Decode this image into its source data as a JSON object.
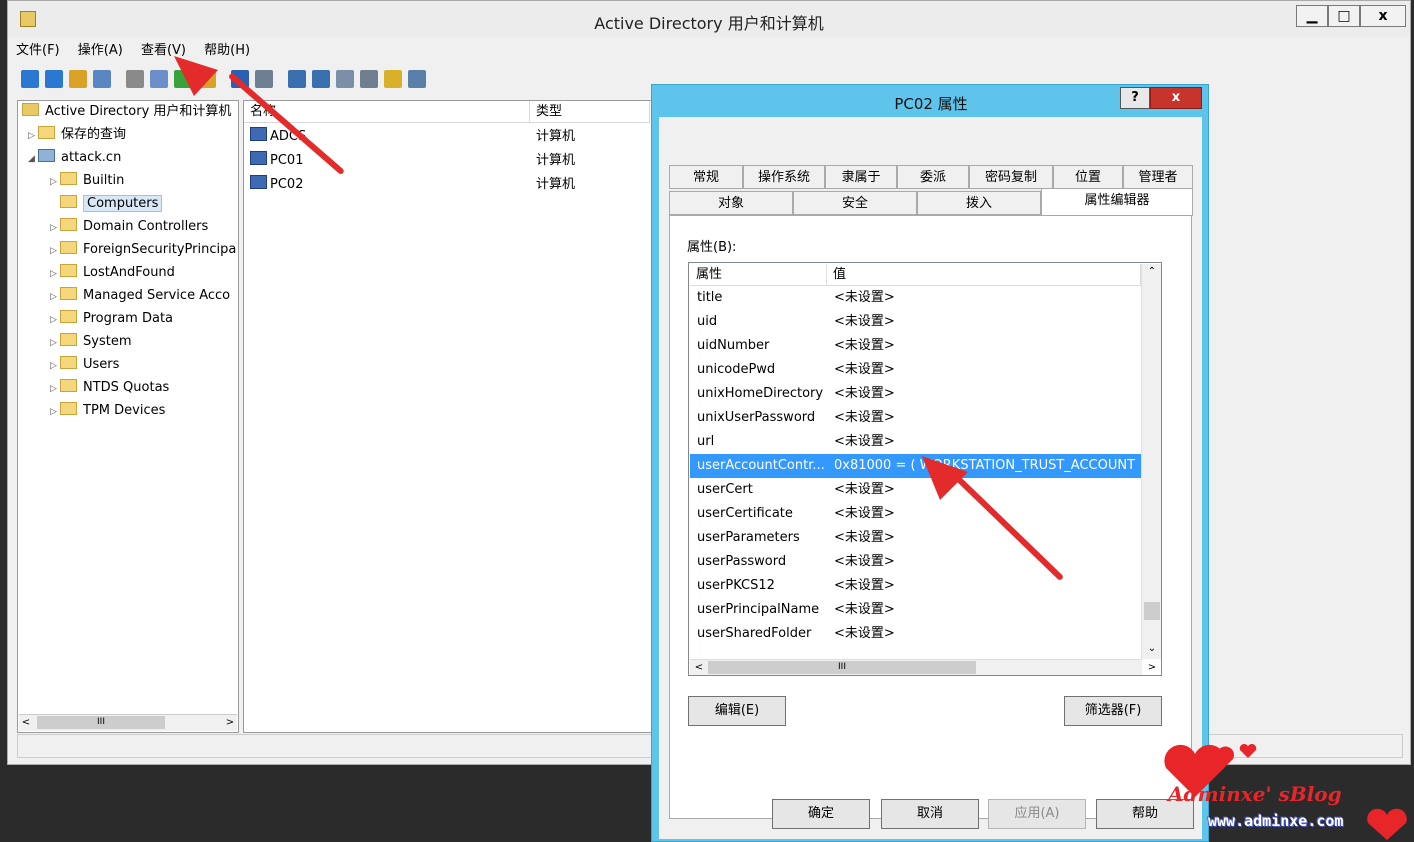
{
  "window": {
    "title": "Active Directory 用户和计算机",
    "controls": {
      "minimize": "▁",
      "maximize": "□",
      "close": "x"
    }
  },
  "menu": [
    "文件(F)",
    "操作(A)",
    "查看(V)",
    "帮助(H)"
  ],
  "toolbar_icons": [
    "back-icon",
    "forward-icon",
    "up-icon",
    "show-tree-icon",
    "clipboard-icon",
    "export-icon",
    "refresh-icon",
    "export-list-icon",
    "help-icon",
    "console-icon",
    "new-user-icon",
    "new-group-icon",
    "new-ou-icon",
    "filter-icon",
    "find-icon",
    "add-to-group-icon"
  ],
  "tree": {
    "root": "Active Directory 用户和计算机",
    "saved_queries": "保存的查询",
    "domain": "attack.cn",
    "children": [
      "Builtin",
      "Computers",
      "Domain Controllers",
      "ForeignSecurityPrincipa",
      "LostAndFound",
      "Managed Service Acco",
      "Program Data",
      "System",
      "Users",
      "NTDS Quotas",
      "TPM Devices"
    ],
    "selected": "Computers",
    "scroll_label": "III"
  },
  "list": {
    "headers": [
      "名称",
      "类型"
    ],
    "rows": [
      {
        "name": "ADCS",
        "type": "计算机"
      },
      {
        "name": "PC01",
        "type": "计算机"
      },
      {
        "name": "PC02",
        "type": "计算机"
      }
    ]
  },
  "dialog": {
    "title": "PC02 属性",
    "help": "?",
    "close": "x",
    "tabs_row1": [
      "常规",
      "操作系统",
      "隶属于",
      "委派",
      "密码复制",
      "位置",
      "管理者"
    ],
    "tabs_row2": [
      "对象",
      "安全",
      "拨入",
      "属性编辑器"
    ],
    "active_tab": "属性编辑器",
    "attributes_label": "属性(B):",
    "columns": [
      "属性",
      "值"
    ],
    "rows": [
      {
        "name": "title",
        "value": "<未设置>"
      },
      {
        "name": "uid",
        "value": "<未设置>"
      },
      {
        "name": "uidNumber",
        "value": "<未设置>"
      },
      {
        "name": "unicodePwd",
        "value": "<未设置>"
      },
      {
        "name": "unixHomeDirectory",
        "value": "<未设置>"
      },
      {
        "name": "unixUserPassword",
        "value": "<未设置>"
      },
      {
        "name": "url",
        "value": "<未设置>"
      },
      {
        "name": "userAccountContr...",
        "value": "0x81000 = ( WORKSTATION_TRUST_ACCOUNT"
      },
      {
        "name": "userCert",
        "value": "<未设置>"
      },
      {
        "name": "userCertificate",
        "value": "<未设置>"
      },
      {
        "name": "userParameters",
        "value": "<未设置>"
      },
      {
        "name": "userPassword",
        "value": "<未设置>"
      },
      {
        "name": "userPKCS12",
        "value": "<未设置>"
      },
      {
        "name": "userPrincipalName",
        "value": "<未设置>"
      },
      {
        "name": "userSharedFolder",
        "value": "<未设置>"
      }
    ],
    "selected_row": 7,
    "scroll_label": "III",
    "edit_button": "编辑(E)",
    "filter_button": "筛选器(F)",
    "ok_button": "确定",
    "cancel_button": "取消",
    "apply_button": "应用(A)",
    "help_button": "帮助"
  },
  "watermark": {
    "line1": "Adminxe' sBlog",
    "line2": "www.adminxe.com"
  },
  "colors": {
    "selection": "#3399ff",
    "dialog_frame": "#5fc4ec",
    "close_red": "#c7342b",
    "arrow_red": "#e32b2b"
  }
}
